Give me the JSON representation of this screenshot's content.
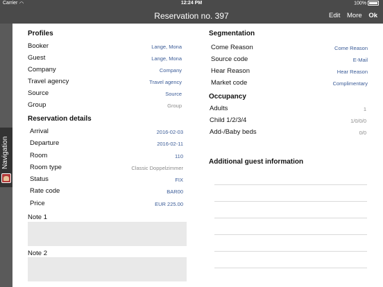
{
  "status_bar": {
    "carrier": "Carrier",
    "wifi": "◠",
    "time": "12:24 PM",
    "battery": "100%"
  },
  "nav": {
    "title": "Reservation no. 397",
    "edit": "Edit",
    "more": "More",
    "ok": "Ok"
  },
  "side": {
    "label": "Navigation"
  },
  "profiles": {
    "title": "Profiles",
    "rows": [
      {
        "key": "Booker",
        "value": "Lange, Mona"
      },
      {
        "key": "Guest",
        "value": "Lange, Mona"
      },
      {
        "key": "Company",
        "value": "Company"
      },
      {
        "key": "Travel agency",
        "value": "Travel agency"
      },
      {
        "key": "Source",
        "value": "Source"
      },
      {
        "key": "Group",
        "value": "Group"
      }
    ]
  },
  "reservation": {
    "title": "Reservation details",
    "rows": [
      {
        "key": "Arrival",
        "value": "2016-02-03"
      },
      {
        "key": "Departure",
        "value": "2016-02-11"
      },
      {
        "key": "Room",
        "value": "110"
      },
      {
        "key": "Room type",
        "value": "Classic Doppelzimmer"
      },
      {
        "key": "Status",
        "value": "FIX"
      },
      {
        "key": "Rate code",
        "value": "BAR00"
      },
      {
        "key": "Price",
        "value": "EUR 225.00"
      }
    ]
  },
  "notes": {
    "note1": "Note 1",
    "note2": "Note 2"
  },
  "segmentation": {
    "title": "Segmentation",
    "rows": [
      {
        "key": "Come Reason",
        "value": "Come Reason"
      },
      {
        "key": "Source code",
        "value": "E-Mail"
      },
      {
        "key": "Hear Reason",
        "value": "Hear Reason"
      },
      {
        "key": "Market code",
        "value": "Complimentary"
      }
    ]
  },
  "occupancy": {
    "title": "Occupancy",
    "rows": [
      {
        "key": "Adults",
        "value": "1"
      },
      {
        "key": "Child 1/2/3/4",
        "value": "1/0/0/0"
      },
      {
        "key": "Add-/Baby beds",
        "value": "0/0"
      }
    ]
  },
  "additional": {
    "title": "Additional guest information"
  },
  "colors": {
    "bar": "#4a4a4a",
    "link": "#3a5b97",
    "muted": "#8a8a8a",
    "note_bg": "#e9e9e9"
  }
}
